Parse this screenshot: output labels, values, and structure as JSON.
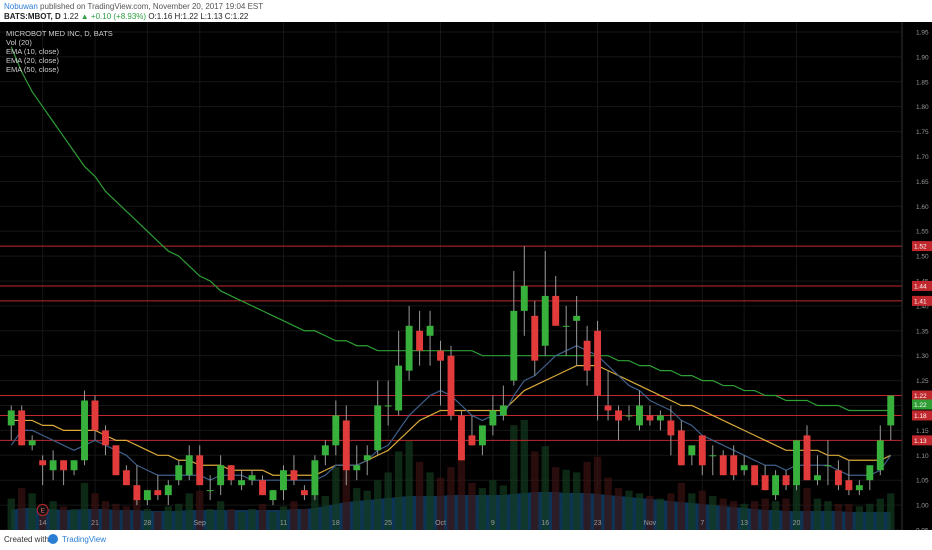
{
  "header": {
    "author": "Nobuwan",
    "published_text": "published on TradingView.com, November 20, 2017 19:04 EST",
    "symbol": "BATS:MBOT, D",
    "last": "1.22",
    "change": "▲ +0.10 (+8.93%)",
    "ohlc": "O:1.16 H:1.22 L:1.13 C:1.22"
  },
  "footer": {
    "created_with": "Created with",
    "brand": "TradingView"
  },
  "chart_data": {
    "type": "candlestick",
    "title": "MICROBOT MED INC, D, BATS",
    "indicators": [
      "Vol (20)",
      "EMA (10, close)",
      "EMA (20, close)",
      "EMA (50, close)"
    ],
    "ylim": [
      0.95,
      1.97
    ],
    "y_ticks": [
      "1.95",
      "1.90",
      "1.85",
      "1.80",
      "1.75",
      "1.70",
      "1.65",
      "1.60",
      "1.55",
      "1.50",
      "1.45",
      "1.40",
      "1.35",
      "1.30",
      "1.25",
      "1.20",
      "1.15",
      "1.10",
      "1.05",
      "1.00",
      "0.95"
    ],
    "x_labels": [
      "14",
      "21",
      "28",
      "Sep",
      "11",
      "18",
      "25",
      "Oct",
      "9",
      "16",
      "23",
      "Nov",
      "7",
      "13",
      "20"
    ],
    "x_label_index": [
      3,
      8,
      13,
      18,
      26,
      31,
      36,
      41,
      46,
      51,
      56,
      61,
      66,
      70,
      75
    ],
    "event_marker": {
      "label": "E",
      "index": 3
    },
    "hlines": [
      {
        "price": 1.52,
        "label": "1.52"
      },
      {
        "price": 1.44,
        "label": "1.44"
      },
      {
        "price": 1.41,
        "label": "1.41"
      },
      {
        "price": 1.22,
        "label": "1.22"
      },
      {
        "price": 1.18,
        "label": "1.18"
      },
      {
        "price": 1.13,
        "label": "1.13"
      }
    ],
    "price_label": "1.22",
    "ohlc": [
      [
        1.16,
        1.2,
        1.13,
        1.19
      ],
      [
        1.19,
        1.2,
        1.12,
        1.12
      ],
      [
        1.12,
        1.14,
        1.11,
        1.13
      ],
      [
        1.09,
        1.1,
        1.04,
        1.08
      ],
      [
        1.07,
        1.11,
        1.05,
        1.09
      ],
      [
        1.09,
        1.09,
        1.04,
        1.07
      ],
      [
        1.07,
        1.09,
        1.06,
        1.09
      ],
      [
        1.09,
        1.23,
        1.08,
        1.21
      ],
      [
        1.21,
        1.22,
        1.13,
        1.15
      ],
      [
        1.15,
        1.16,
        1.1,
        1.12
      ],
      [
        1.12,
        1.12,
        1.06,
        1.06
      ],
      [
        1.07,
        1.08,
        1.04,
        1.04
      ],
      [
        1.04,
        1.08,
        1.0,
        1.01
      ],
      [
        1.01,
        1.03,
        1.0,
        1.03
      ],
      [
        1.03,
        1.06,
        1.01,
        1.02
      ],
      [
        1.02,
        1.05,
        1.0,
        1.04
      ],
      [
        1.05,
        1.09,
        1.04,
        1.08
      ],
      [
        1.06,
        1.12,
        1.05,
        1.1
      ],
      [
        1.1,
        1.12,
        1.06,
        1.04
      ],
      [
        1.03,
        1.06,
        1.01,
        1.03
      ],
      [
        1.04,
        1.1,
        1.02,
        1.08
      ],
      [
        1.08,
        1.08,
        1.04,
        1.05
      ],
      [
        1.04,
        1.07,
        1.03,
        1.05
      ],
      [
        1.05,
        1.07,
        1.04,
        1.06
      ],
      [
        1.05,
        1.06,
        1.02,
        1.02
      ],
      [
        1.01,
        1.03,
        1.0,
        1.03
      ],
      [
        1.03,
        1.08,
        1.01,
        1.07
      ],
      [
        1.07,
        1.1,
        1.04,
        1.05
      ],
      [
        1.03,
        1.04,
        1.01,
        1.02
      ],
      [
        1.02,
        1.1,
        1.01,
        1.09
      ],
      [
        1.1,
        1.13,
        1.08,
        1.12
      ],
      [
        1.12,
        1.21,
        1.1,
        1.18
      ],
      [
        1.17,
        1.2,
        1.04,
        1.07
      ],
      [
        1.07,
        1.12,
        1.05,
        1.08
      ],
      [
        1.09,
        1.12,
        1.06,
        1.1
      ],
      [
        1.11,
        1.25,
        1.1,
        1.2
      ],
      [
        1.2,
        1.25,
        1.16,
        1.2
      ],
      [
        1.19,
        1.35,
        1.18,
        1.28
      ],
      [
        1.27,
        1.4,
        1.25,
        1.36
      ],
      [
        1.35,
        1.39,
        1.28,
        1.31
      ],
      [
        1.34,
        1.39,
        1.28,
        1.36
      ],
      [
        1.31,
        1.33,
        1.2,
        1.29
      ],
      [
        1.3,
        1.32,
        1.17,
        1.18
      ],
      [
        1.18,
        1.19,
        1.09,
        1.09
      ],
      [
        1.14,
        1.18,
        1.12,
        1.12
      ],
      [
        1.12,
        1.16,
        1.1,
        1.16
      ],
      [
        1.16,
        1.22,
        1.14,
        1.19
      ],
      [
        1.18,
        1.24,
        1.17,
        1.2
      ],
      [
        1.25,
        1.47,
        1.24,
        1.39
      ],
      [
        1.39,
        1.52,
        1.34,
        1.44
      ],
      [
        1.38,
        1.41,
        1.26,
        1.29
      ],
      [
        1.32,
        1.51,
        1.3,
        1.42
      ],
      [
        1.42,
        1.46,
        1.38,
        1.36
      ],
      [
        1.36,
        1.4,
        1.3,
        1.36
      ],
      [
        1.37,
        1.42,
        1.28,
        1.38
      ],
      [
        1.33,
        1.36,
        1.24,
        1.27
      ],
      [
        1.35,
        1.37,
        1.17,
        1.22
      ],
      [
        1.2,
        1.27,
        1.17,
        1.19
      ],
      [
        1.19,
        1.2,
        1.13,
        1.17
      ],
      [
        1.18,
        1.2,
        1.17,
        1.18
      ],
      [
        1.16,
        1.23,
        1.15,
        1.2
      ],
      [
        1.18,
        1.2,
        1.16,
        1.17
      ],
      [
        1.17,
        1.19,
        1.15,
        1.18
      ],
      [
        1.17,
        1.2,
        1.1,
        1.14
      ],
      [
        1.15,
        1.17,
        1.08,
        1.08
      ],
      [
        1.1,
        1.12,
        1.08,
        1.12
      ],
      [
        1.14,
        1.14,
        1.06,
        1.08
      ],
      [
        1.1,
        1.12,
        1.06,
        1.1
      ],
      [
        1.1,
        1.11,
        1.06,
        1.06
      ],
      [
        1.1,
        1.12,
        1.05,
        1.06
      ],
      [
        1.07,
        1.1,
        1.06,
        1.08
      ],
      [
        1.08,
        1.08,
        1.04,
        1.04
      ],
      [
        1.06,
        1.08,
        1.03,
        1.03
      ],
      [
        1.02,
        1.07,
        1.01,
        1.06
      ],
      [
        1.06,
        1.07,
        1.03,
        1.04
      ],
      [
        1.04,
        1.13,
        1.03,
        1.13
      ],
      [
        1.14,
        1.16,
        1.08,
        1.05
      ],
      [
        1.05,
        1.1,
        1.04,
        1.06
      ],
      [
        1.08,
        1.13,
        1.04,
        1.08
      ],
      [
        1.07,
        1.09,
        1.03,
        1.04
      ],
      [
        1.05,
        1.09,
        1.02,
        1.03
      ],
      [
        1.03,
        1.05,
        1.02,
        1.04
      ],
      [
        1.05,
        1.08,
        1.03,
        1.08
      ],
      [
        1.07,
        1.16,
        1.06,
        1.13
      ],
      [
        1.16,
        1.22,
        1.13,
        1.22
      ]
    ],
    "ema10": [
      1.12,
      1.15,
      1.15,
      1.14,
      1.13,
      1.12,
      1.11,
      1.12,
      1.13,
      1.12,
      1.11,
      1.1,
      1.08,
      1.07,
      1.06,
      1.06,
      1.06,
      1.06,
      1.06,
      1.05,
      1.06,
      1.06,
      1.06,
      1.05,
      1.05,
      1.05,
      1.05,
      1.05,
      1.05,
      1.05,
      1.06,
      1.08,
      1.08,
      1.08,
      1.09,
      1.11,
      1.12,
      1.15,
      1.18,
      1.2,
      1.22,
      1.23,
      1.22,
      1.2,
      1.18,
      1.17,
      1.18,
      1.18,
      1.22,
      1.25,
      1.26,
      1.28,
      1.3,
      1.31,
      1.32,
      1.31,
      1.3,
      1.28,
      1.26,
      1.24,
      1.23,
      1.21,
      1.2,
      1.19,
      1.17,
      1.16,
      1.14,
      1.13,
      1.12,
      1.11,
      1.1,
      1.09,
      1.08,
      1.08,
      1.07,
      1.08,
      1.08,
      1.08,
      1.08,
      1.07,
      1.06,
      1.06,
      1.06,
      1.07,
      1.1
    ],
    "ema20": [
      1.17,
      1.17,
      1.17,
      1.16,
      1.16,
      1.15,
      1.15,
      1.15,
      1.15,
      1.14,
      1.13,
      1.13,
      1.12,
      1.11,
      1.1,
      1.1,
      1.09,
      1.09,
      1.08,
      1.08,
      1.08,
      1.07,
      1.07,
      1.07,
      1.07,
      1.06,
      1.06,
      1.06,
      1.06,
      1.06,
      1.07,
      1.08,
      1.08,
      1.08,
      1.09,
      1.1,
      1.11,
      1.13,
      1.15,
      1.17,
      1.18,
      1.19,
      1.19,
      1.19,
      1.19,
      1.19,
      1.19,
      1.19,
      1.21,
      1.23,
      1.24,
      1.25,
      1.26,
      1.27,
      1.28,
      1.28,
      1.28,
      1.27,
      1.26,
      1.25,
      1.24,
      1.23,
      1.22,
      1.21,
      1.2,
      1.2,
      1.19,
      1.18,
      1.17,
      1.16,
      1.15,
      1.14,
      1.13,
      1.12,
      1.11,
      1.11,
      1.11,
      1.11,
      1.1,
      1.1,
      1.09,
      1.09,
      1.09,
      1.09,
      1.1
    ],
    "ema50": [
      1.92,
      1.87,
      1.83,
      1.8,
      1.77,
      1.74,
      1.71,
      1.68,
      1.66,
      1.63,
      1.61,
      1.59,
      1.57,
      1.55,
      1.53,
      1.51,
      1.5,
      1.48,
      1.46,
      1.45,
      1.43,
      1.42,
      1.41,
      1.4,
      1.39,
      1.38,
      1.37,
      1.36,
      1.35,
      1.35,
      1.34,
      1.33,
      1.33,
      1.32,
      1.32,
      1.31,
      1.31,
      1.31,
      1.31,
      1.31,
      1.31,
      1.31,
      1.31,
      1.31,
      1.31,
      1.3,
      1.3,
      1.3,
      1.3,
      1.3,
      1.3,
      1.3,
      1.3,
      1.3,
      1.3,
      1.3,
      1.3,
      1.3,
      1.29,
      1.29,
      1.28,
      1.28,
      1.27,
      1.27,
      1.26,
      1.26,
      1.25,
      1.25,
      1.24,
      1.24,
      1.23,
      1.23,
      1.22,
      1.22,
      1.21,
      1.21,
      1.21,
      1.2,
      1.2,
      1.2,
      1.19,
      1.19,
      1.19,
      1.19,
      1.19
    ],
    "volume": [
      60,
      80,
      70,
      50,
      55,
      45,
      40,
      90,
      70,
      55,
      50,
      45,
      60,
      40,
      35,
      45,
      50,
      70,
      75,
      40,
      55,
      40,
      35,
      40,
      50,
      35,
      45,
      55,
      40,
      70,
      65,
      120,
      140,
      80,
      75,
      95,
      110,
      150,
      170,
      130,
      110,
      100,
      120,
      140,
      90,
      80,
      95,
      85,
      200,
      210,
      150,
      160,
      120,
      115,
      110,
      130,
      140,
      100,
      80,
      75,
      70,
      65,
      60,
      70,
      90,
      70,
      75,
      65,
      60,
      55,
      50,
      55,
      60,
      55,
      60,
      90,
      80,
      60,
      55,
      50,
      50,
      45,
      50,
      60,
      70
    ],
    "volume_area": [
      20,
      22,
      22,
      21,
      21,
      20,
      20,
      21,
      21,
      21,
      20,
      20,
      20,
      19,
      19,
      19,
      19,
      20,
      20,
      20,
      20,
      20,
      20,
      20,
      20,
      20,
      20,
      21,
      21,
      22,
      24,
      26,
      28,
      29,
      30,
      31,
      32,
      33,
      34,
      34,
      34,
      34,
      35,
      35,
      35,
      35,
      35,
      35,
      36,
      37,
      38,
      38,
      38,
      37,
      37,
      37,
      36,
      35,
      34,
      33,
      32,
      31,
      30,
      29,
      28,
      27,
      26,
      25,
      24,
      23,
      22,
      21,
      20,
      20,
      19,
      19,
      19,
      19,
      19,
      19,
      18,
      18,
      18,
      18,
      18
    ]
  }
}
